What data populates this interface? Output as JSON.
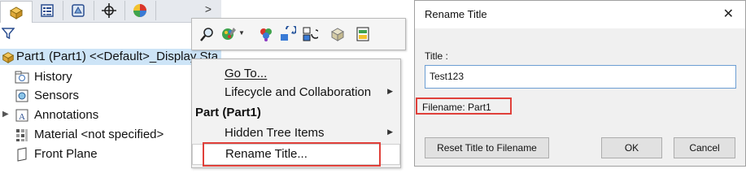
{
  "tree": {
    "root_label": "Part1 (Part1) <<Default>_Display Sta",
    "items": [
      {
        "label": "History",
        "icon": "history-folder-icon",
        "expandable": false
      },
      {
        "label": "Sensors",
        "icon": "sensors-icon",
        "expandable": false
      },
      {
        "label": "Annotations",
        "icon": "annotations-icon",
        "expandable": true
      },
      {
        "label": "Material <not specified>",
        "icon": "material-icon",
        "expandable": false
      },
      {
        "label": "Front Plane",
        "icon": "plane-icon",
        "expandable": false
      }
    ],
    "tabs": [
      "feature-manager-icon",
      "property-manager-icon",
      "configuration-manager-icon",
      "dimxpert-icon",
      "display-manager-icon"
    ],
    "tabs_more_arrow": ">"
  },
  "context_menu": {
    "toolbar_icons": [
      "zoom-to-selection-icon",
      "appearance-icon",
      "scene-icon",
      "rebuild-icon",
      "view-orientation-icon",
      "hide-show-icon",
      "properties-icon"
    ],
    "items": [
      {
        "label": "Go To...",
        "submenu": false
      },
      {
        "label": "Lifecycle and Collaboration",
        "submenu": true
      },
      {
        "label": "Hidden Tree Items",
        "submenu": true
      },
      {
        "label": "Rename Title...",
        "submenu": false
      }
    ],
    "header": "Part (Part1)"
  },
  "dialog": {
    "title": "Rename Title",
    "close_glyph": "✕",
    "field_label": "Title :",
    "title_value": "Test123",
    "filename_label": "Filename: Part1",
    "reset_button": "Reset Title to Filename",
    "ok_button": "OK",
    "cancel_button": "Cancel"
  },
  "colors": {
    "highlight_border": "#e0403a",
    "selection": "#cde4f7"
  }
}
